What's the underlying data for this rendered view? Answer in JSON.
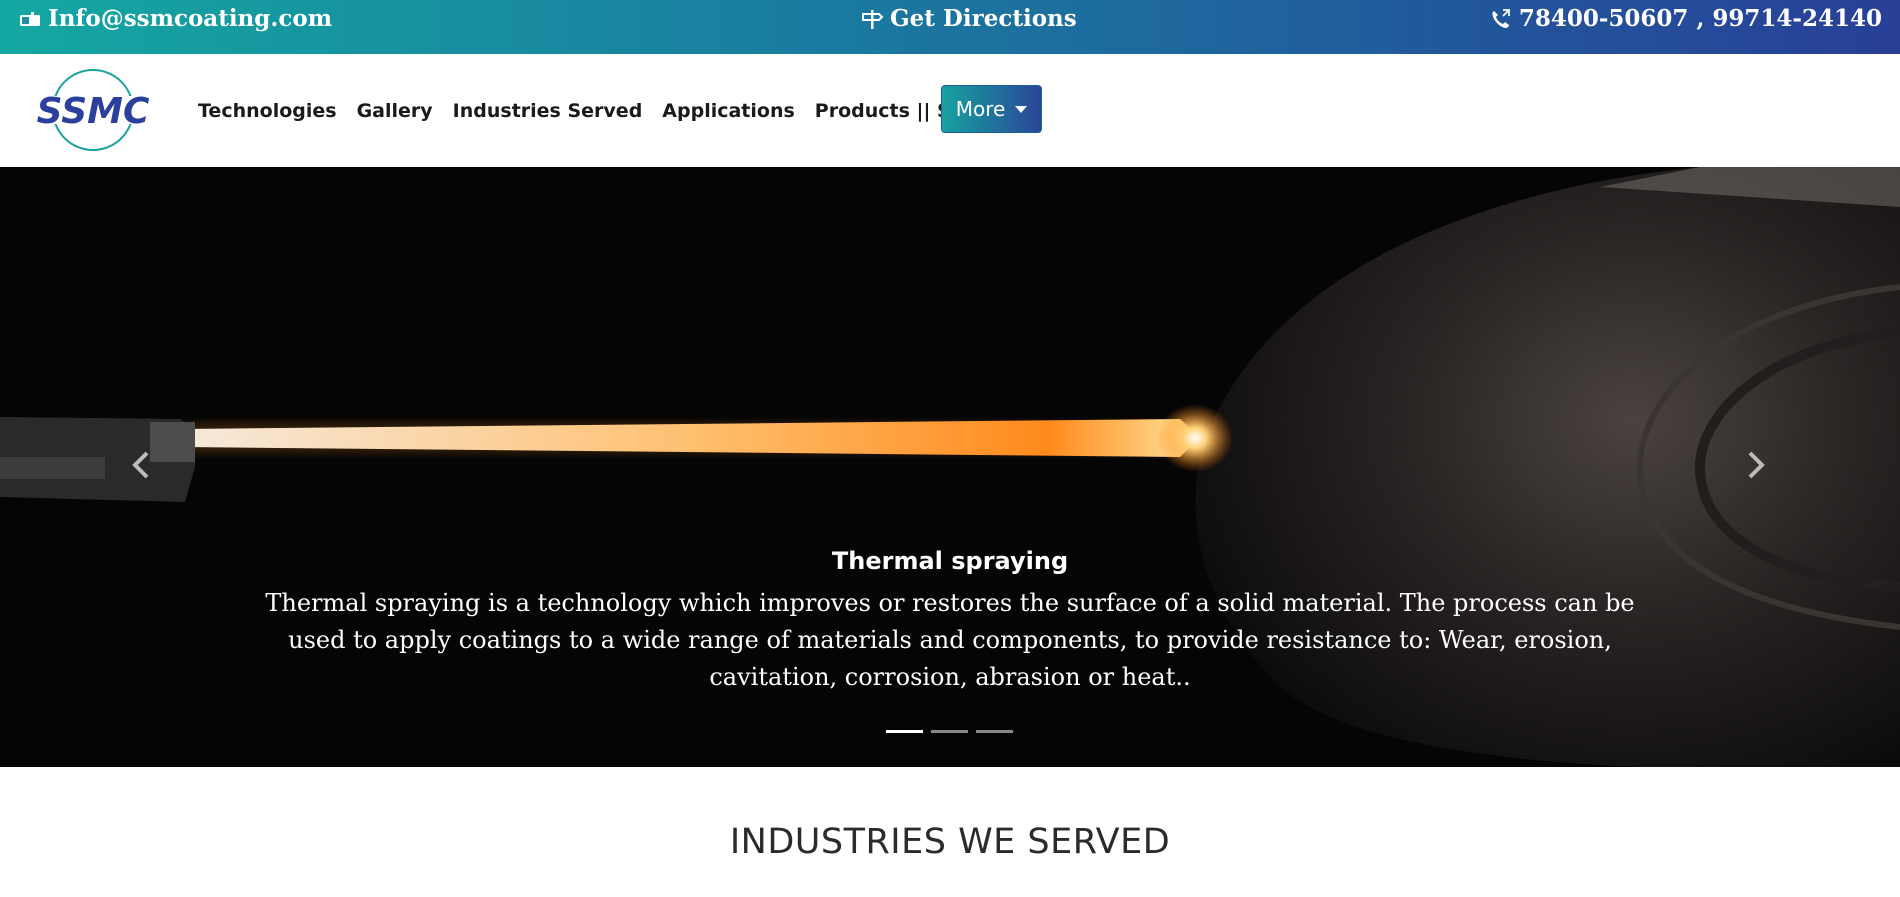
{
  "topbar": {
    "email": "Info@ssmcoating.com",
    "directions": "Get Directions",
    "phone": "78400-50607 , 99714-24140",
    "icons": [
      "envelope-icon",
      "signpost-icon",
      "phone-icon"
    ],
    "gradient": [
      "#14a7a1",
      "#283f98"
    ]
  },
  "nav": {
    "logo_text": "SSMC",
    "items": [
      "Technologies",
      "Gallery",
      "Industries Served",
      "Applications",
      "Products || Services"
    ],
    "more_label": "More"
  },
  "hero": {
    "slide_title": "Thermal spraying",
    "slide_text": "Thermal spraying is a technology which improves or restores the surface of a solid material. The process can be used to apply coatings to a wide range of materials and components, to provide resistance to: Wear, erosion, cavitation, corrosion, abrasion or heat..",
    "slides_total": 3,
    "active_slide": 1
  },
  "section": {
    "title": "INDUSTRIES WE SERVED"
  },
  "colors": {
    "accent_teal": "#17a2a0",
    "accent_blue": "#2a4597",
    "logo_blue": "#2b3f9c"
  }
}
